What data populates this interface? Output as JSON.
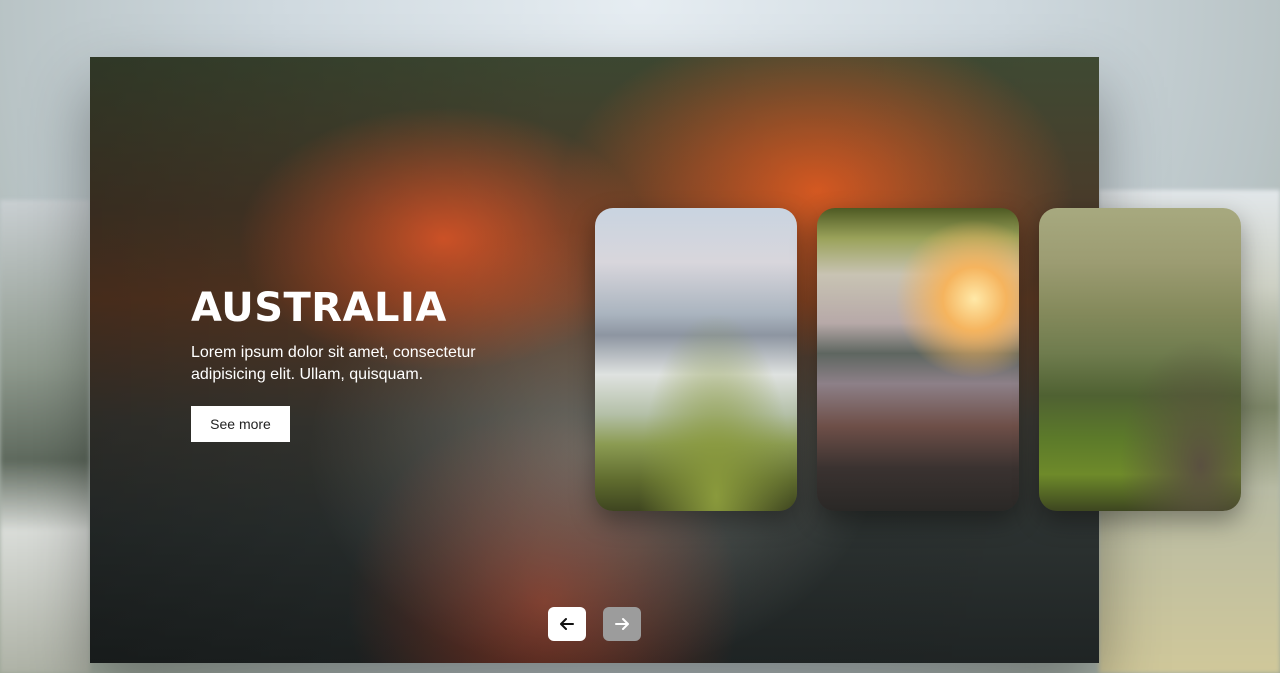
{
  "hero": {
    "title": "AUSTRALIA",
    "description": "Lorem ipsum dolor sit amet, consectetur adipisicing elit. Ullam, quisquam.",
    "button_label": "See more"
  },
  "controls": {
    "prev_icon": "arrow-left-icon",
    "next_icon": "arrow-right-icon"
  },
  "cards": [
    {
      "name": "misty-valley-card"
    },
    {
      "name": "sunset-lake-card"
    },
    {
      "name": "green-mountain-card"
    }
  ],
  "colors": {
    "button_bg": "#ffffff",
    "next_button_bg": "#9c9c9c"
  }
}
